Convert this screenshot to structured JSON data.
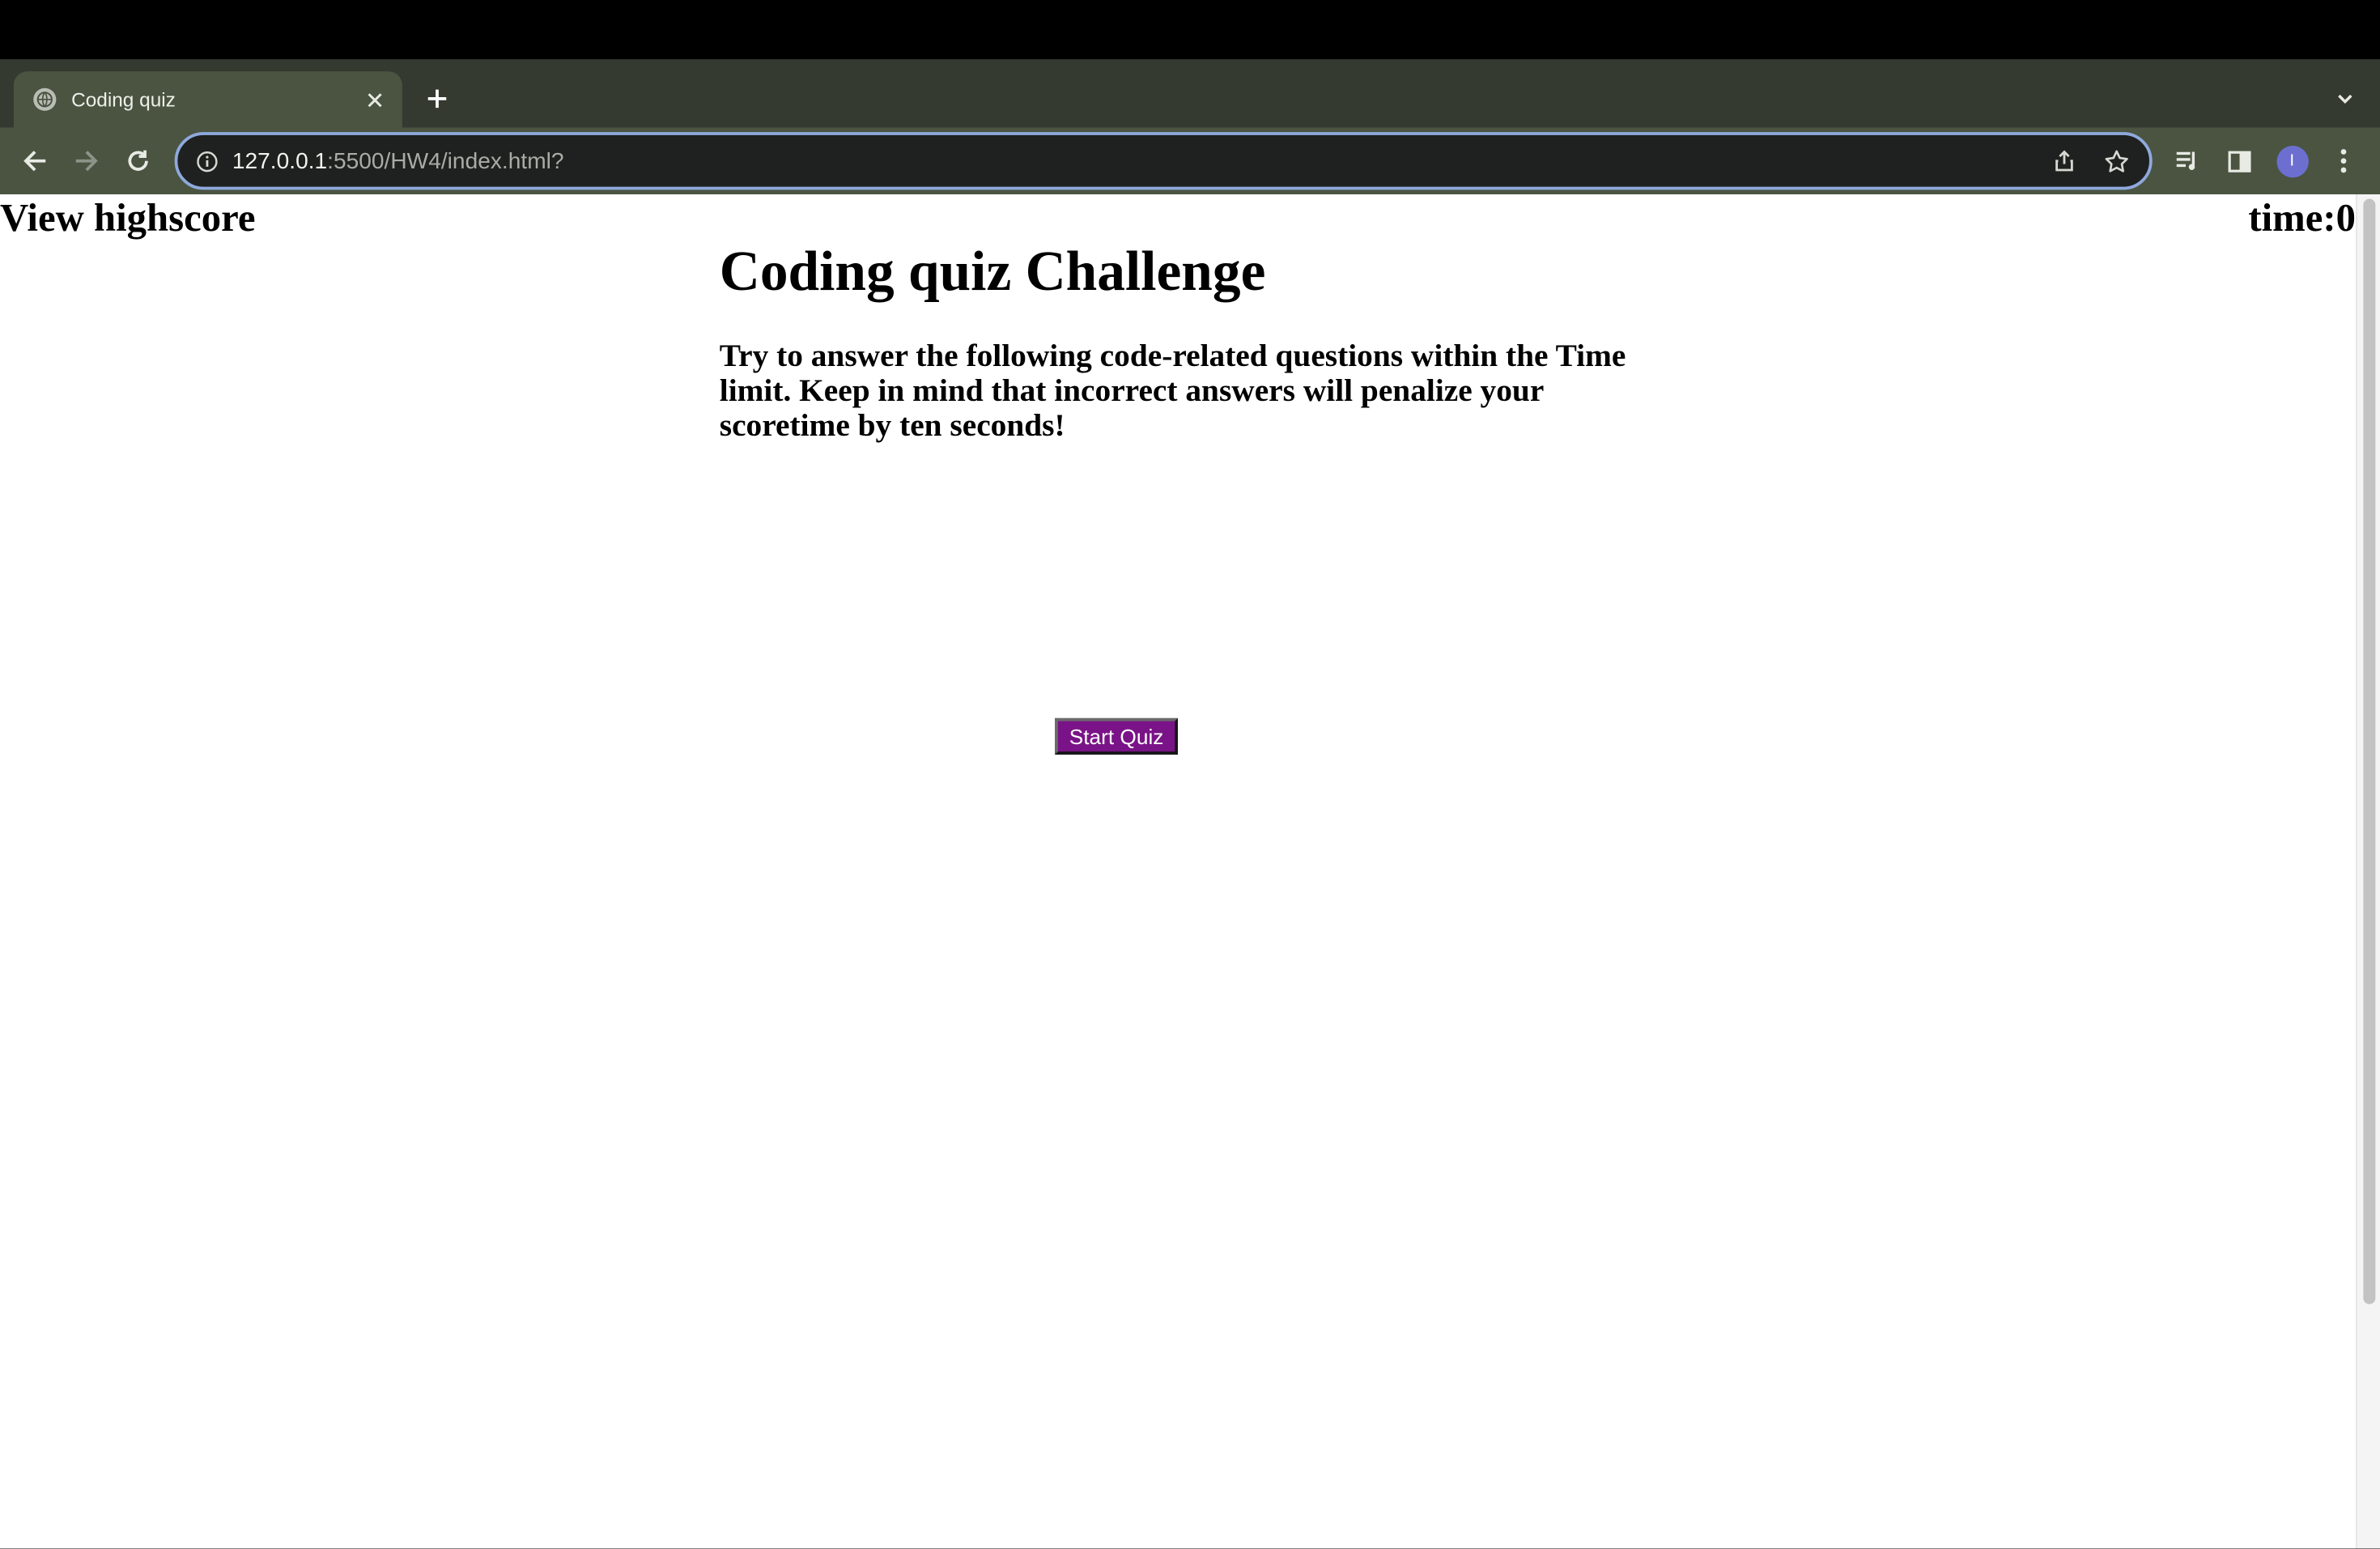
{
  "browser": {
    "tab": {
      "title": "Coding quiz"
    },
    "address_bar": {
      "host": "127.0.0.1",
      "rest": ":5500/HW4/index.html?"
    },
    "profile_initial": "I",
    "icons": {
      "favicon": "globe-icon",
      "tab_close": "close-icon",
      "new_tab": "plus-icon",
      "tab_search": "chevron-down-icon",
      "back": "back-arrow-icon",
      "forward": "forward-arrow-icon",
      "reload": "reload-icon",
      "site_info": "info-icon",
      "share": "share-icon",
      "bookmark": "star-icon",
      "reading_list": "reading-list-icon",
      "side_panel": "side-panel-icon",
      "menu": "kebab-menu-icon"
    },
    "colors": {
      "tabstrip": "#343a2f",
      "toolbar": "#4a5441",
      "omnibox_border": "#8fa9de",
      "avatar": "#6c6fd0"
    }
  },
  "page": {
    "highscore_link": "View highscore",
    "timer": "time:0",
    "title": "Coding quiz Challenge",
    "intro": "Try to answer the following code-related questions within the Time limit. Keep in mind that incorrect answers will penalize your scoretime by ten seconds!",
    "start_button": "Start Quiz",
    "colors": {
      "start_button": "#7a1387"
    }
  }
}
